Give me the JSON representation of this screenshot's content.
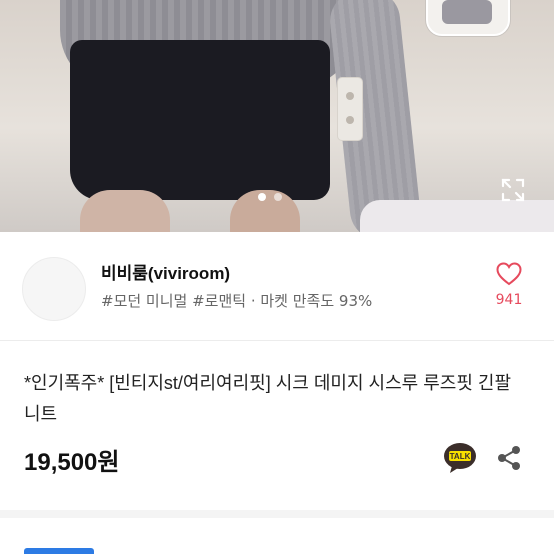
{
  "gallery": {
    "slide_count": 2,
    "active_index": 0
  },
  "seller": {
    "name": "비비룸(viviroom)",
    "tags": "#모던 미니멀 #로맨틱 · 마켓 만족도 93%",
    "likes": "941"
  },
  "product": {
    "title": "*인기폭주* [빈티지st/여리여리핏] 시크 데미지 시스루 루즈핏 긴팔 니트",
    "price": "19,500원"
  },
  "icons": {
    "expand": "expand-icon",
    "heart": "heart-icon",
    "talk": "kakaotalk-icon",
    "share": "share-icon"
  },
  "colors": {
    "accent_heart": "#e64a5d",
    "talk_bg": "#3b2e2a",
    "talk_badge": "#f7df00"
  }
}
